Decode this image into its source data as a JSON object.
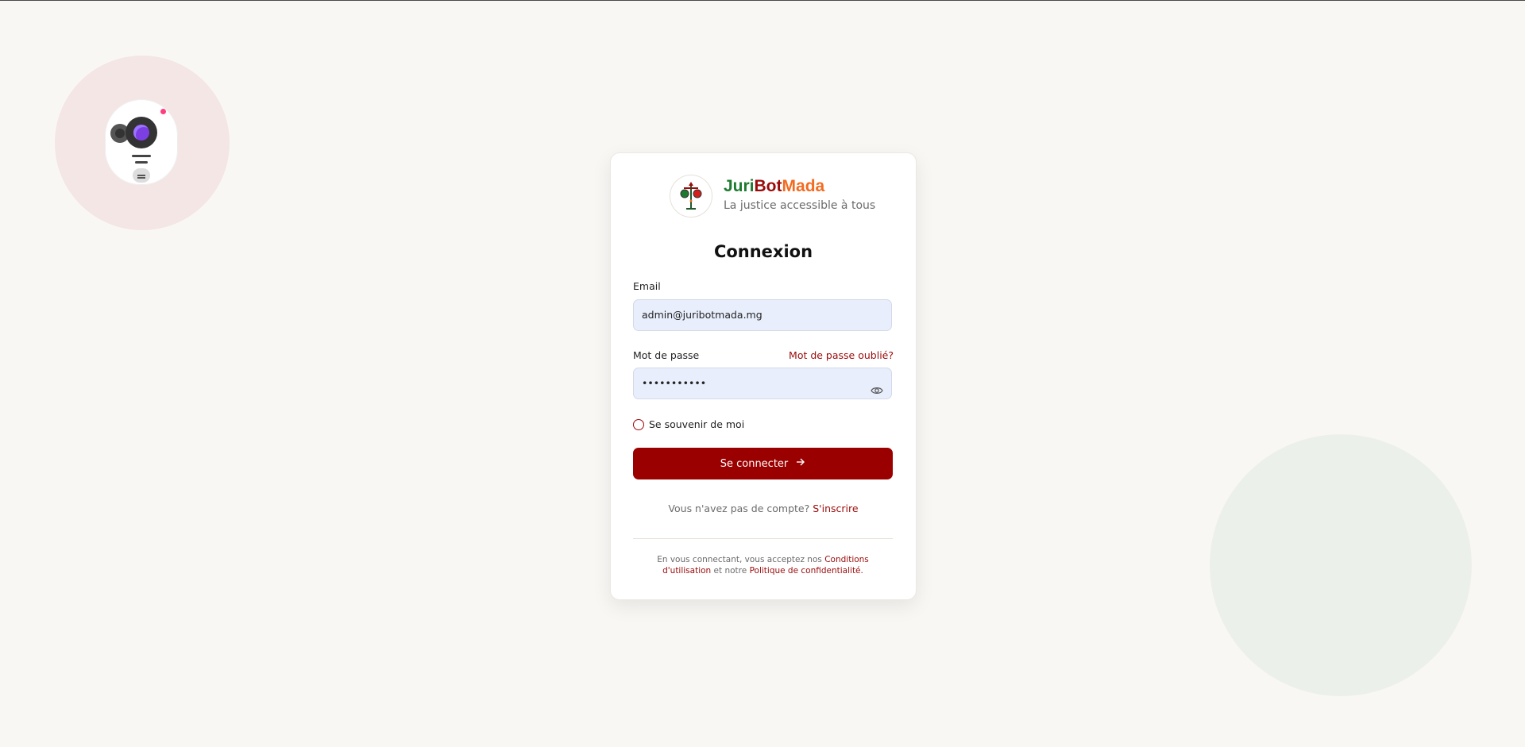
{
  "brand": {
    "name_part1": "Juri",
    "name_part2": "Bot",
    "name_part3": "Mada",
    "tagline": "La justice accessible à tous",
    "colors": {
      "juri": "#1e7a2f",
      "bot": "#9b0a0a",
      "mada": "#f26b20"
    }
  },
  "login": {
    "title": "Connexion",
    "email_label": "Email",
    "email_value": "admin@juribotmada.mg",
    "password_label": "Mot de passe",
    "forgot_link": "Mot de passe oublié?",
    "password_value": "•••••••••••",
    "remember_label": "Se souvenir de moi",
    "submit_label": "Se connecter",
    "no_account_text": "Vous n'avez pas de compte?",
    "signup_link": "S'inscrire",
    "legal_prefix": "En vous connectant, vous acceptez nos",
    "terms_link": "Conditions d'utilisation",
    "legal_middle": "et notre",
    "privacy_link": "Politique de confidentialité",
    "legal_suffix": ".",
    "accent_color": "#9b0000"
  },
  "icons": {
    "logo": "scales-of-justice-icon",
    "password_toggle": "eye-icon",
    "submit_arrow": "arrow-right-icon",
    "assistant": "robot-assistant-icon"
  }
}
